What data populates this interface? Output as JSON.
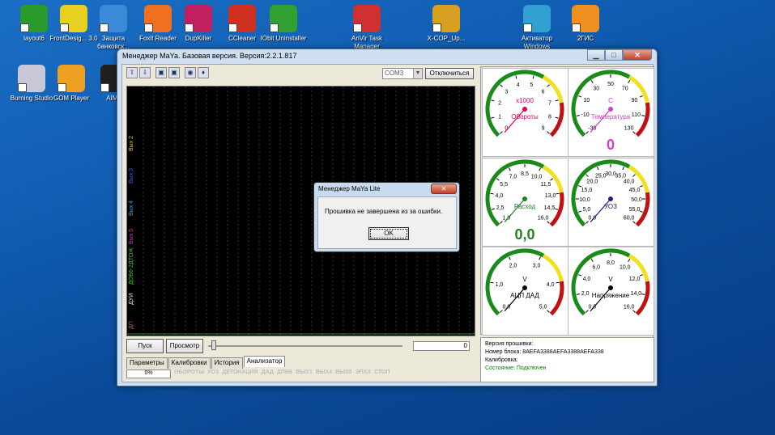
{
  "desktop": {
    "icons": [
      {
        "label": "layout6",
        "color": "#2a9a2a"
      },
      {
        "label": "FrontDesig... 3.0",
        "color": "#e8d020"
      },
      {
        "label": "Защита банковск...",
        "color": "#3a8ad8"
      },
      {
        "label": "Foxit Reader",
        "color": "#f07020"
      },
      {
        "label": "DupKiller",
        "color": "#c02060"
      },
      {
        "label": "CCleaner",
        "color": "#d03020"
      },
      {
        "label": "IObit Uninstaller",
        "color": "#30a030"
      },
      {
        "label": "AnVir Task Manager",
        "color": "#d03030"
      },
      {
        "label": "X-COP_Up...",
        "color": "#d8a020"
      },
      {
        "label": "Активатор Windows",
        "color": "#30a0d0"
      },
      {
        "label": "2ГИС",
        "color": "#f09020"
      },
      {
        "label": "Burning Studio",
        "color": "#c8c8d8"
      },
      {
        "label": "GOM Player",
        "color": "#f0a020"
      },
      {
        "label": "AIMP",
        "color": "#202020"
      }
    ]
  },
  "window": {
    "title": "Менеджер MaYa. Базовая версия. Версия:2.2.1.817",
    "min": "▁",
    "max": "□",
    "close": "✕"
  },
  "toolbar": {
    "com_port": "COM3",
    "disconnect": "Отключиться"
  },
  "channels": [
    "Вых 2",
    "Вых 3",
    "Вых 4",
    "Вых 5",
    "ДТОЖ",
    "ДОБ6-2",
    "ДУИ",
    "ДП"
  ],
  "controls": {
    "start": "Пуск",
    "view": "Просмотр",
    "counter": "0"
  },
  "tabs": [
    "Параметры",
    "Калибровки",
    "История",
    "Анализатор"
  ],
  "status": {
    "progress": "0%",
    "items": [
      "ОБОРОТЫ",
      "УОЗ",
      "ДЕТОНАЦИЯ",
      "ДАД",
      "ДПКВ",
      "ВЫХ1",
      "ВЫХ4",
      "ВЫХ5",
      "ЭПХХ",
      "СТОП"
    ]
  },
  "gauges": [
    {
      "id": "rpm",
      "label": "Обороты",
      "mult": "x1000",
      "ticks": [
        "0",
        "1",
        "2",
        "3",
        "4",
        "5",
        "6",
        "7",
        "8",
        "9"
      ],
      "color": "#e00060",
      "value": null
    },
    {
      "id": "temp",
      "label": "Температура",
      "mult": "С",
      "ticks": [
        "-30",
        "-10",
        "10",
        "30",
        "50",
        "70",
        "90",
        "110",
        "130"
      ],
      "color": "#d040d0",
      "value": "0"
    },
    {
      "id": "flow",
      "label": "Расход",
      "mult": "",
      "ticks": [
        "1,0",
        "2,5",
        "4,0",
        "5,5",
        "7,0",
        "8,5",
        "10,0",
        "11,5",
        "13,0",
        "14,5",
        "16,0"
      ],
      "color": "#208020",
      "value": "0,0"
    },
    {
      "id": "uoz",
      "label": "УОЗ",
      "mult": "",
      "ticks": [
        "0,0",
        "5,0",
        "10,0",
        "15,0",
        "20,0",
        "25,0",
        "30,0",
        "35,0",
        "40,0",
        "45,0",
        "50,0",
        "55,0",
        "60,0"
      ],
      "color": "#202080",
      "value": null
    },
    {
      "id": "dad",
      "label": "АЦП ДАД",
      "mult": "V",
      "ticks": [
        "0,0",
        "1,0",
        "2,0",
        "3,0",
        "4,0",
        "5,0"
      ],
      "color": "#000000",
      "value": null
    },
    {
      "id": "volt",
      "label": "Напряжение",
      "mult": "V",
      "ticks": [
        "0,0",
        "2,0",
        "4,0",
        "6,0",
        "8,0",
        "10,0",
        "12,0",
        "14,0",
        "16,0"
      ],
      "color": "#000000",
      "value": null
    }
  ],
  "info": {
    "fw": "Версия прошивки:",
    "block": "Номер блока: 8AEFA3388AEFA3388AEFA338",
    "calib": "Калибровка:",
    "state": "Состояние: Подключен"
  },
  "dialog": {
    "title": "Менеджер MaYa Lite",
    "message": "Прошивка не завершена из за ошибки.",
    "ok": "OK",
    "close": "✕"
  }
}
